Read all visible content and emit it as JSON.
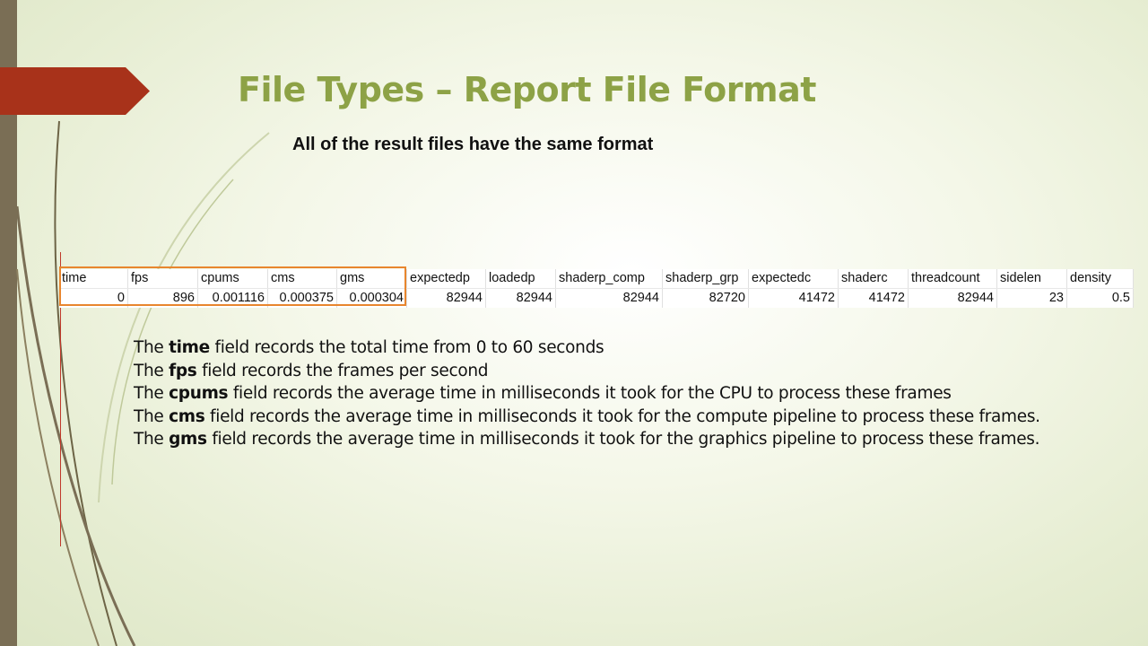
{
  "slide": {
    "title": "File Types – Report File Format",
    "subtitle": "All of the result files have the same format"
  },
  "table": {
    "headers": [
      "time",
      "fps",
      "cpums",
      "cms",
      "gms",
      "expectedp",
      "loadedp",
      "shaderp_comp",
      "shaderp_grp",
      "expectedc",
      "shaderc",
      "threadcount",
      "sidelen",
      "density"
    ],
    "values": [
      "0",
      "896",
      "0.001116",
      "0.000375",
      "0.000304",
      "82944",
      "82944",
      "82944",
      "82720",
      "41472",
      "41472",
      "82944",
      "23",
      "0.5"
    ]
  },
  "descriptions": [
    {
      "pre": "The ",
      "field": "time",
      "post": " field records the total time from 0 to 60 seconds"
    },
    {
      "pre": "The ",
      "field": "fps",
      "post": " field records the frames per second"
    },
    {
      "pre": "The ",
      "field": "cpums",
      "post": " field records the average time in milliseconds it took for the CPU to process these frames"
    },
    {
      "pre": "The ",
      "field": "cms",
      "post": "  field records the average time in milliseconds it took for the compute pipeline to process these frames."
    },
    {
      "pre": "The ",
      "field": "gms",
      "post": "  field records the average time in milliseconds it took for the graphics pipeline to process these frames."
    }
  ],
  "colors": {
    "title": "#8da246",
    "accent_tab": "#a8321a",
    "left_bar": "#7a6e55",
    "selection": "#e8862e"
  }
}
